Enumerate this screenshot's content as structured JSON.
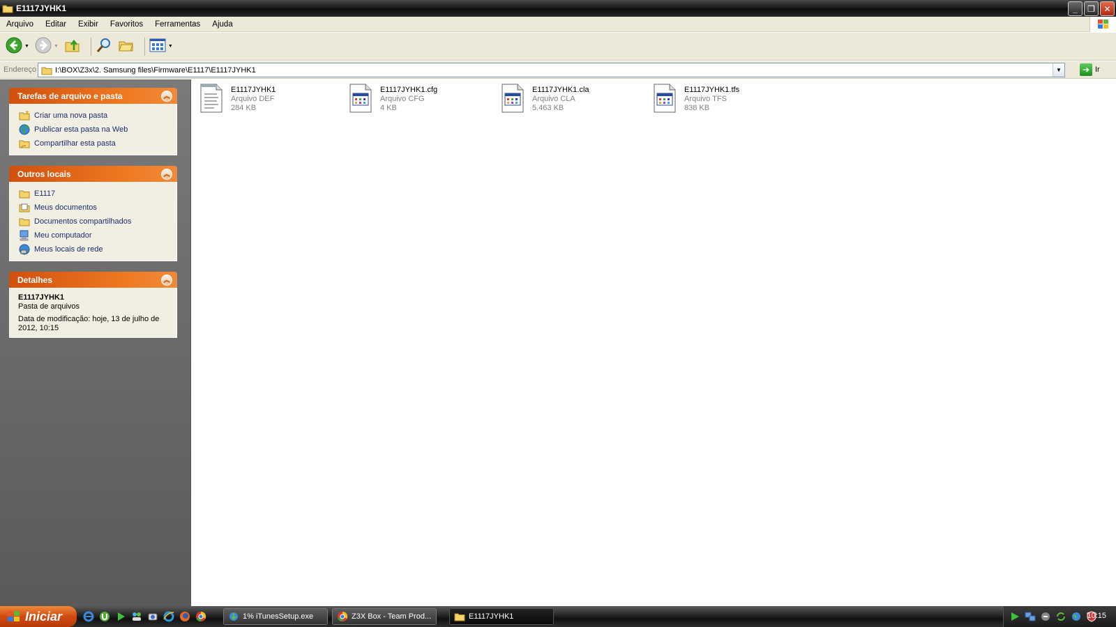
{
  "window": {
    "title": "E1117JYHK1",
    "icon": "folder-icon",
    "controls": [
      "minimize",
      "restore",
      "close"
    ]
  },
  "menu": {
    "items": [
      "Arquivo",
      "Editar",
      "Exibir",
      "Favoritos",
      "Ferramentas",
      "Ajuda"
    ]
  },
  "toolbar": {
    "buttons": [
      "back-icon",
      "forward-icon",
      "up-folder-icon",
      "search-icon",
      "folders-icon",
      "views-icon"
    ]
  },
  "address": {
    "label": "Endereço",
    "value": "I:\\BOX\\Z3x\\2. Samsung files\\Firmware\\E1117\\E1117JYHK1",
    "go_label": "Ir"
  },
  "sidebar": {
    "tasks": {
      "title": "Tarefas de arquivo e pasta",
      "items": [
        {
          "label": "Criar uma nova pasta",
          "icon": "new-folder-icon"
        },
        {
          "label": "Publicar esta pasta na Web",
          "icon": "globe-icon"
        },
        {
          "label": "Compartilhar esta pasta",
          "icon": "share-folder-icon"
        }
      ]
    },
    "other_places": {
      "title": "Outros locais",
      "items": [
        {
          "label": "E1117",
          "icon": "folder-icon"
        },
        {
          "label": "Meus documentos",
          "icon": "documents-icon"
        },
        {
          "label": "Documentos compartilhados",
          "icon": "folder-icon"
        },
        {
          "label": "Meu computador",
          "icon": "computer-icon"
        },
        {
          "label": "Meus locais de rede",
          "icon": "network-icon"
        }
      ]
    },
    "details": {
      "title": "Detalhes",
      "name": "E1117JYHK1",
      "type": "Pasta de arquivos",
      "modified": "Data de modificação: hoje, 13 de julho de 2012, 10:15"
    }
  },
  "files": [
    {
      "name": "E1117JYHK1",
      "type": "Arquivo DEF",
      "size": "284 KB",
      "icon": "text-file-icon"
    },
    {
      "name": "E1117JYHK1.cfg",
      "type": "Arquivo CFG",
      "size": "4 KB",
      "icon": "app-file-icon"
    },
    {
      "name": "E1117JYHK1.cla",
      "type": "Arquivo CLA",
      "size": "5.463 KB",
      "icon": "app-file-icon"
    },
    {
      "name": "E1117JYHK1.tfs",
      "type": "Arquivo TFS",
      "size": "838 KB",
      "icon": "app-file-icon"
    }
  ],
  "taskbar": {
    "start_label": "Iniciar",
    "quick_launch": [
      "ie-icon",
      "utorrent-icon",
      "media-player-icon",
      "msn-icon",
      "camera-icon",
      "ie-alt-icon",
      "firefox-icon",
      "chrome-icon"
    ],
    "tasks": [
      {
        "label": "1% iTunesSetup.exe",
        "icon": "download-icon"
      },
      {
        "label": "Z3X Box - Team Prod...",
        "icon": "chrome-icon"
      },
      {
        "label": "E1117JYHK1",
        "icon": "folder-icon"
      }
    ],
    "clock": "10:15"
  }
}
